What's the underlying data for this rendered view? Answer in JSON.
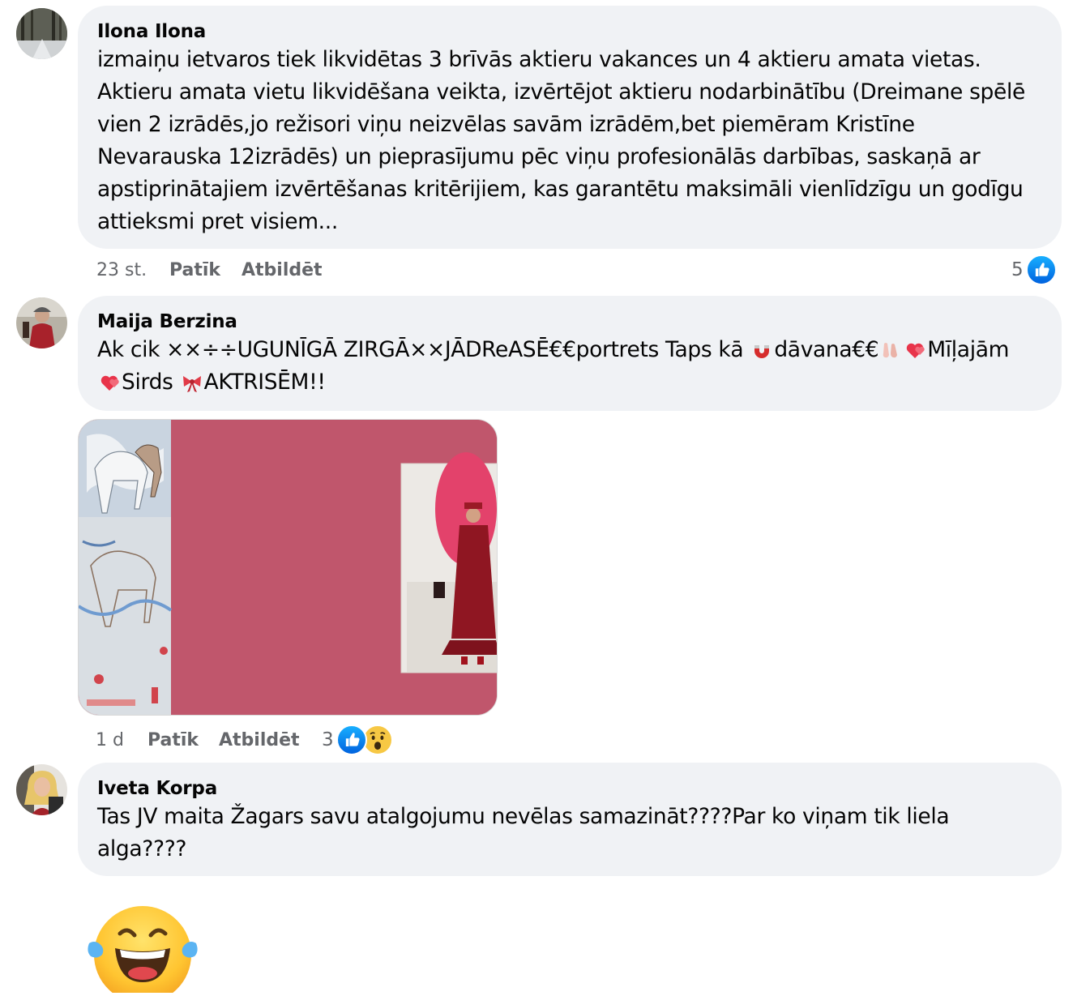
{
  "comments": [
    {
      "author": "Ilona Ilona",
      "lines": [
        "izmaiņu ietvaros tiek likvidētas 3 brīvās aktieru vakances un 4 aktieru amata vietas.",
        "Aktieru amata vietu likvidēšana veikta, izvērtējot aktieru nodarbinātību (Dreimane spēlē",
        "vien 2 izrādēs,jo režisori viņu neizvēlas savām izrādēm,bet piemēram Kristīne",
        "Nevarauska 12izrādēs) un pieprasījumu pēc viņu profesionālās darbības, saskaņā ar",
        "apstiprinātajiem izvērtēšanas kritērijiem, kas garantētu maksimāli vienlīdzīgu un godīgu",
        "attieksmi pret visiem..."
      ],
      "time": "23 st.",
      "like_label": "Patīk",
      "reply_label": "Atbildēt",
      "reaction_count": "5",
      "reactions": [
        "like-icon"
      ]
    },
    {
      "author": "Maija Berzina",
      "line1_a": "Ak cik ××÷÷UGUNĪGĀ ZIRGĀ××JĀDReASĒ€€portrets Taps kā ",
      "line1_b": "dāvana€€",
      "line1_c": "Mīļajām",
      "line2_a": "Sirds ",
      "line2_b": "AKTRISĒM!!",
      "inline_emojis": [
        "magnet-emoji",
        "ballet-shoes-emoji",
        "heart-emoji",
        "heart-emoji",
        "ribbon-emoji"
      ],
      "time": "1 d",
      "like_label": "Patīk",
      "reply_label": "Atbildēt",
      "reaction_count": "3",
      "reactions": [
        "like-icon",
        "wow-icon"
      ],
      "attachment": "horse-painting-and-portrait-photo"
    },
    {
      "author": "Iveta Korpa",
      "lines": [
        "Tas JV maita Žagars savu atalgojumu nevēlas samazināt????Par ko viņam tik liela",
        "alga????"
      ]
    }
  ],
  "trailing_sticker": "laughing-tears-emoji",
  "colors": {
    "bubble_bg": "#f0f2f5",
    "meta_text": "#65676b",
    "like_blue": "#0866ff",
    "attachment_bg": "#c0566c"
  }
}
